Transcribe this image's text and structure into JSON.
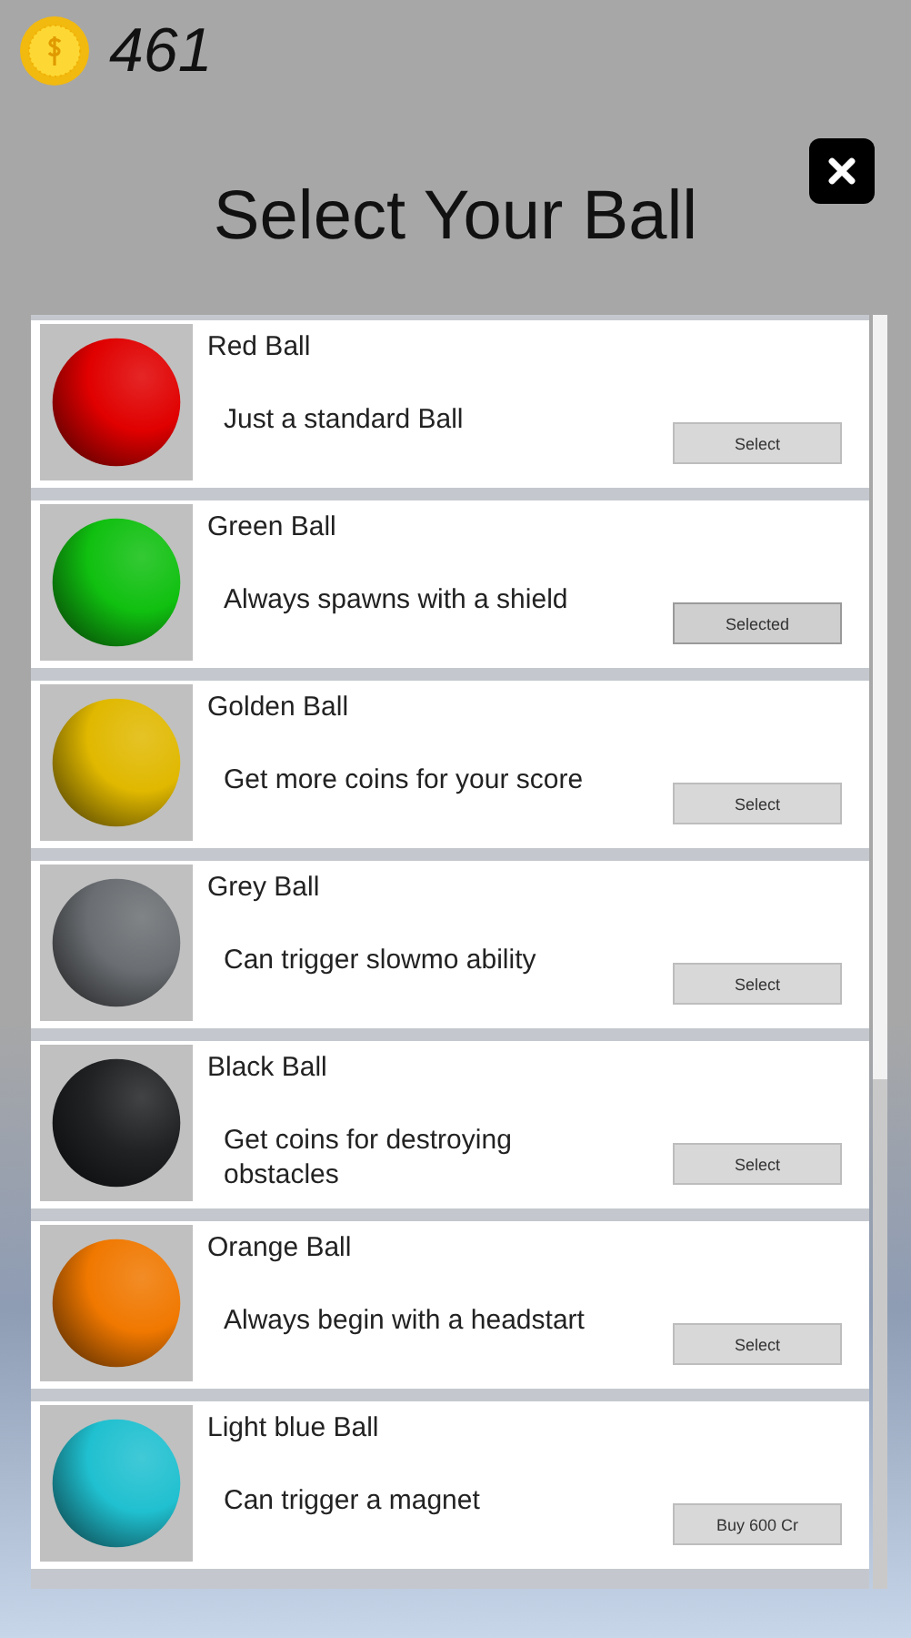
{
  "coins": "461",
  "title": "Select Your Ball",
  "balls": [
    {
      "name": "Red Ball",
      "description": "Just a standard Ball",
      "button": "Select",
      "selected": false,
      "color": "#e00000"
    },
    {
      "name": "Green Ball",
      "description": "Always spawns with a shield",
      "button": "Selected",
      "selected": true,
      "color": "#10c010"
    },
    {
      "name": "Golden Ball",
      "description": "Get more coins for your score",
      "button": "Select",
      "selected": false,
      "color": "#e0b800"
    },
    {
      "name": "Grey Ball",
      "description": "Can trigger slowmo ability",
      "button": "Select",
      "selected": false,
      "color": "#6a6e72"
    },
    {
      "name": "Black Ball",
      "description": "Get coins for destroying obstacles",
      "button": "Select",
      "selected": false,
      "color": "#202224"
    },
    {
      "name": "Orange Ball",
      "description": "Always begin with a headstart",
      "button": "Select",
      "selected": false,
      "color": "#f07800"
    },
    {
      "name": "Light blue Ball",
      "description": "Can trigger a magnet",
      "button": "Buy 600 Cr",
      "selected": false,
      "color": "#20c0d0"
    }
  ]
}
